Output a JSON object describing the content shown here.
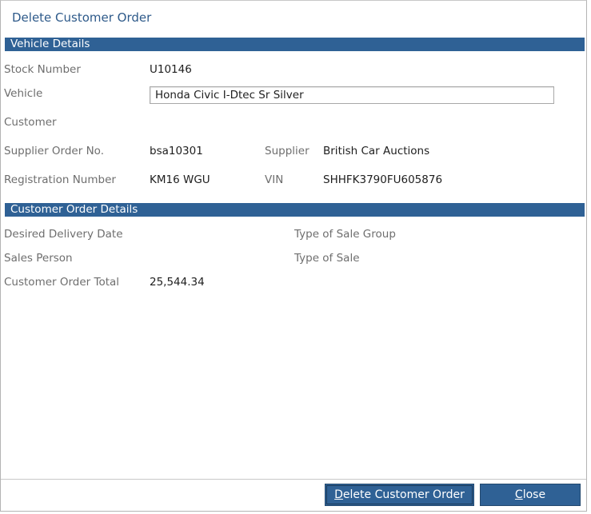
{
  "dialog": {
    "title": "Delete Customer Order"
  },
  "vehicle_section": {
    "header": "Vehicle Details",
    "stock_number_label": "Stock Number",
    "stock_number_value": "U10146",
    "vehicle_label": "Vehicle",
    "vehicle_value": "Honda Civic I-Dtec Sr Silver",
    "customer_label": "Customer",
    "customer_value": "",
    "supplier_order_label": "Supplier Order No.",
    "supplier_order_value": "bsa10301",
    "supplier_label": "Supplier",
    "supplier_value": "British Car Auctions",
    "registration_label": "Registration Number",
    "registration_value": "KM16 WGU",
    "vin_label": "VIN",
    "vin_value": "SHHFK3790FU605876"
  },
  "order_section": {
    "header": "Customer Order Details",
    "delivery_date_label": "Desired Delivery Date",
    "delivery_date_value": "",
    "sale_group_label": "Type of Sale Group",
    "sale_group_value": "",
    "sales_person_label": "Sales Person",
    "sales_person_value": "",
    "sale_type_label": "Type of Sale",
    "sale_type_value": "",
    "order_total_label": "Customer Order Total",
    "order_total_value": "25,544.34"
  },
  "buttons": {
    "delete_first": "D",
    "delete_rest": "elete Customer Order",
    "close_first": "C",
    "close_rest": "lose"
  },
  "colors": {
    "section_bar": "#2f6195",
    "title": "#2e5a8a",
    "label": "#6e6e6e"
  }
}
